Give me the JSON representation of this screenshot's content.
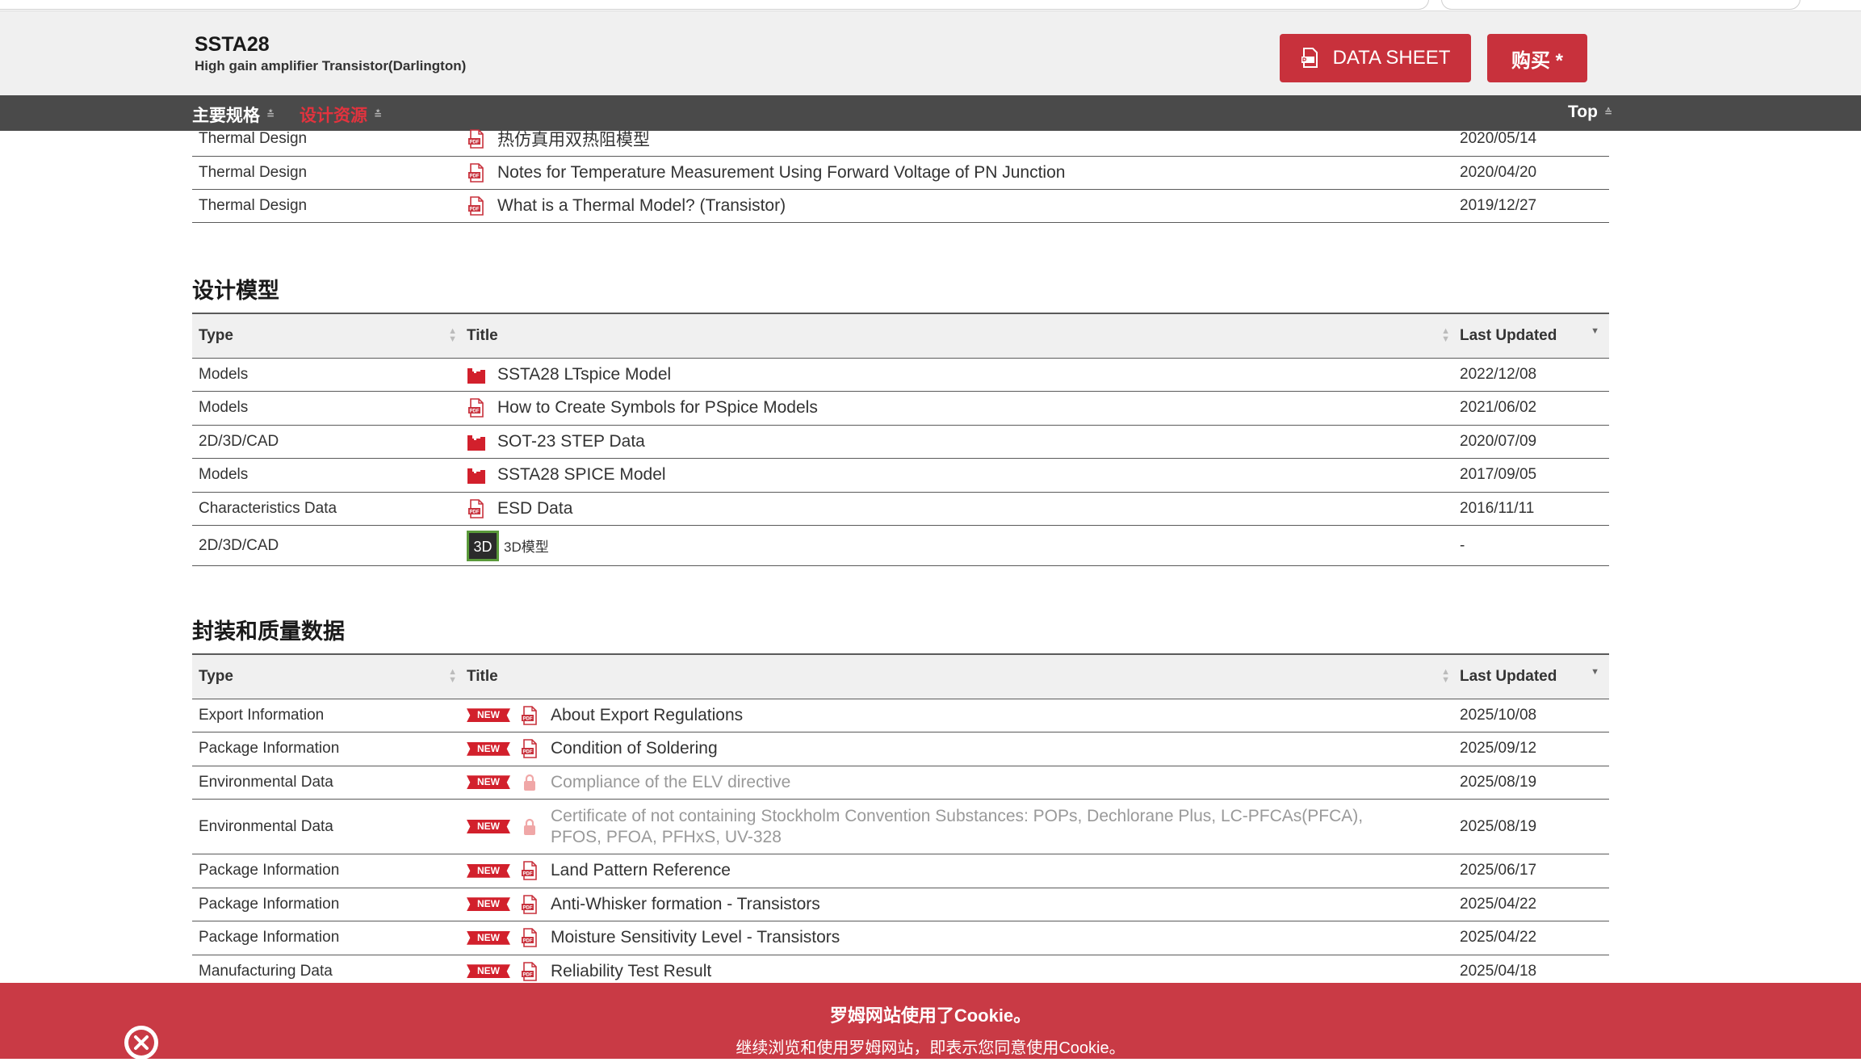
{
  "header": {
    "product_name": "SSTA28",
    "product_desc": "High gain amplifier Transistor(Darlington)",
    "datasheet_label": "DATA SHEET",
    "buy_label": "购买 *"
  },
  "nav": {
    "specs": "主要规格",
    "design": "设计资源",
    "top": "Top"
  },
  "colors": {
    "brand_red": "#c8313c",
    "nav_bg": "#4a4a4a",
    "header_bg": "#f0f0f0"
  },
  "thermal_rows": [
    {
      "type": "Thermal Design",
      "title": "热仿真用双热阻模型",
      "date": "2020/05/14",
      "icon": "pdf-icon"
    },
    {
      "type": "Thermal Design",
      "title": "Notes for Temperature Measurement Using Forward Voltage of PN Junction",
      "date": "2020/04/20",
      "icon": "pdf-icon"
    },
    {
      "type": "Thermal Design",
      "title": "What is a Thermal Model? (Transistor)",
      "date": "2019/12/27",
      "icon": "pdf-icon"
    }
  ],
  "design_models": {
    "heading": "设计模型",
    "columns": {
      "type": "Type",
      "title": "Title",
      "updated": "Last Updated"
    },
    "rows": [
      {
        "type": "Models",
        "title": "SSTA28 LTspice Model",
        "date": "2022/12/08",
        "icon": "zip-icon"
      },
      {
        "type": "Models",
        "title": "How to Create Symbols for PSpice Models",
        "date": "2021/06/02",
        "icon": "pdf-icon"
      },
      {
        "type": "2D/3D/CAD",
        "title": "SOT-23 STEP Data",
        "date": "2020/07/09",
        "icon": "zip-icon"
      },
      {
        "type": "Models",
        "title": "SSTA28 SPICE Model",
        "date": "2017/09/05",
        "icon": "zip-icon"
      },
      {
        "type": "Characteristics Data",
        "title": "ESD Data",
        "date": "2016/11/11",
        "icon": "pdf-icon"
      },
      {
        "type": "2D/3D/CAD",
        "title": "3D模型",
        "date": "-",
        "icon": "3d-model-icon",
        "icon_label": "3D"
      }
    ]
  },
  "package_quality": {
    "heading": "封装和质量数据",
    "columns": {
      "type": "Type",
      "title": "Title",
      "updated": "Last Updated"
    },
    "new_label": "NEW",
    "rows": [
      {
        "type": "Export Information",
        "title": "About Export Regulations",
        "date": "2025/10/08",
        "icon": "pdf-icon",
        "locked": false
      },
      {
        "type": "Package Information",
        "title": "Condition of Soldering",
        "date": "2025/09/12",
        "icon": "pdf-icon",
        "locked": false
      },
      {
        "type": "Environmental Data",
        "title": "Compliance of the ELV directive",
        "date": "2025/08/19",
        "icon": "lock-icon",
        "locked": true
      },
      {
        "type": "Environmental Data",
        "title": "Certificate of not containing Stockholm Convention Substances: POPs, Dechlorane Plus, LC-PFCAs(PFCA), PFOS, PFOA, PFHxS, UV-328",
        "date": "2025/08/19",
        "icon": "lock-icon",
        "locked": true
      },
      {
        "type": "Package Information",
        "title": "Land Pattern Reference",
        "date": "2025/06/17",
        "icon": "pdf-icon",
        "locked": false
      },
      {
        "type": "Package Information",
        "title": "Anti-Whisker formation - Transistors",
        "date": "2025/04/22",
        "icon": "pdf-icon",
        "locked": false
      },
      {
        "type": "Package Information",
        "title": "Moisture Sensitivity Level - Transistors",
        "date": "2025/04/22",
        "icon": "pdf-icon",
        "locked": false
      },
      {
        "type": "Manufacturing Data",
        "title": "Reliability Test Result",
        "date": "2025/04/18",
        "icon": "pdf-icon",
        "locked": false
      }
    ]
  },
  "cookie": {
    "title": "罗姆网站使用了Cookie。",
    "text": "继续浏览和使用罗姆网站，即表示您同意使用Cookie。"
  }
}
